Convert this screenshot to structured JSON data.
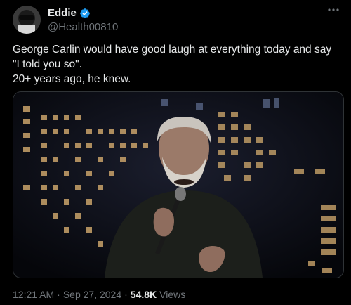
{
  "author": {
    "display_name": "Eddie",
    "handle": "@Health00810",
    "verified": true,
    "verified_color": "#1d9bf0"
  },
  "tweet": {
    "text": "George Carlin would have good laugh at everything today and say \"I told you so\".\n20+ years ago, he knew."
  },
  "media": {
    "kind": "video-still"
  },
  "meta": {
    "time": "12:21 AM",
    "separator1": "·",
    "date": "Sep 27, 2024",
    "separator2": "·",
    "views_count": "54.8K",
    "views_label": "Views"
  },
  "icons": {
    "more": "more-options-icon",
    "verified": "verified-badge-icon"
  }
}
